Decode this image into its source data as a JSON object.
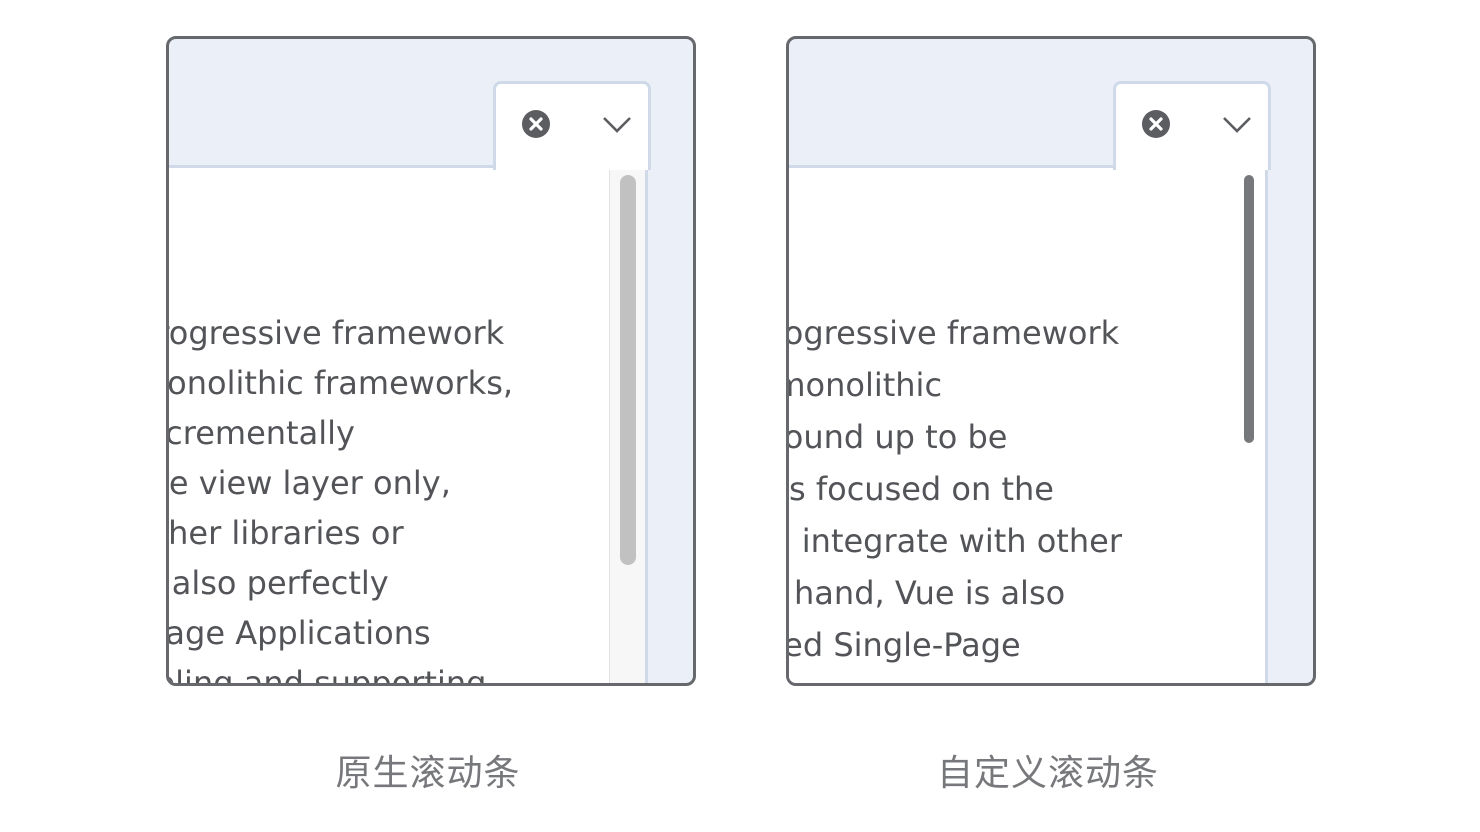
{
  "native": {
    "caption": "原生滚动条",
    "lines": [
      "progressive framework",
      "monolithic frameworks,",
      "incrementally",
      "the view layer only,",
      "other libraries or",
      "is also perfectly",
      "-Page Applications",
      "ooling and supporting"
    ]
  },
  "custom": {
    "caption": "自定义滚动条",
    "lines": [
      "progressive framework",
      "r monolithic",
      "ground up to be",
      "y is focused on the",
      "nd integrate with other",
      "er hand, Vue is also",
      "ated Single-Page"
    ]
  },
  "colors": {
    "frame_border": "#66686c",
    "frame_bg": "#ebf0f8",
    "text": "#525458",
    "native_thumb": "#c1c1c1",
    "custom_thumb": "#77787b"
  },
  "icons": [
    "clear-icon",
    "chevron-down-icon"
  ]
}
